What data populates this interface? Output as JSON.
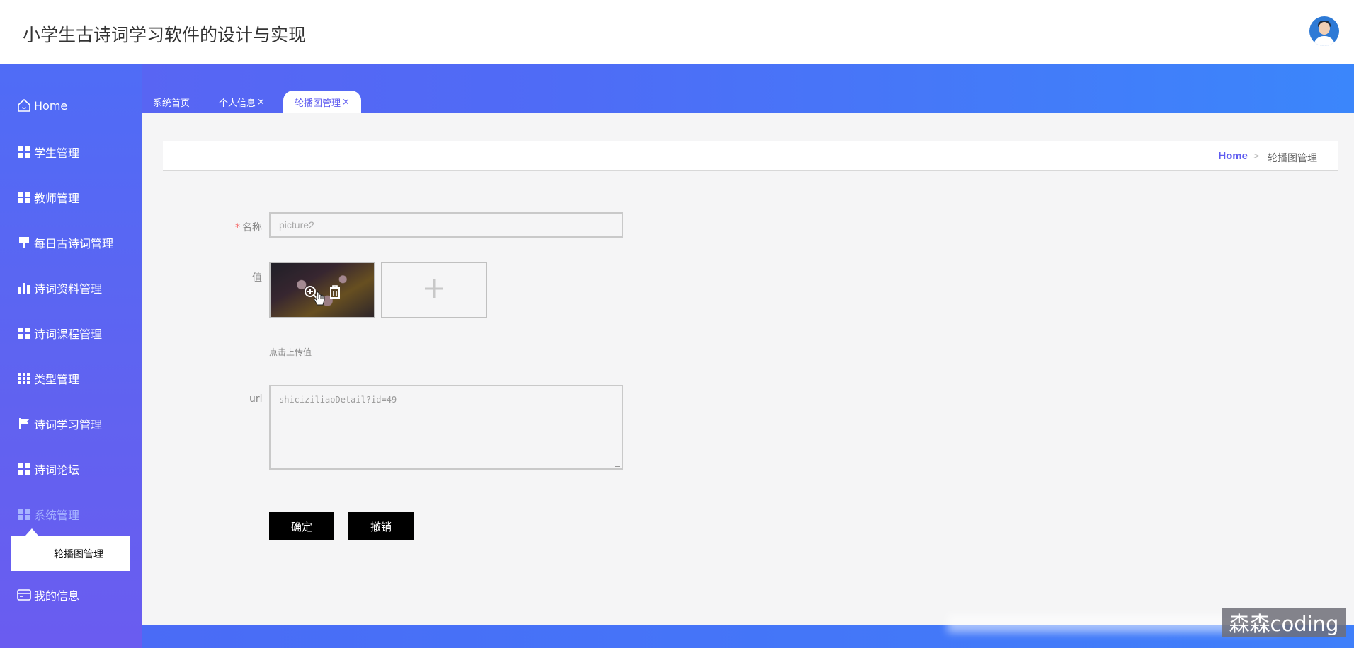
{
  "app": {
    "title": "小学生古诗词学习软件的设计与实现"
  },
  "sidebar": {
    "items": [
      {
        "label": "Home",
        "icon": "home-icon"
      },
      {
        "label": "学生管理",
        "icon": "grid-icon"
      },
      {
        "label": "教师管理",
        "icon": "grid-icon"
      },
      {
        "label": "每日古诗词管理",
        "icon": "brush-icon"
      },
      {
        "label": "诗词资料管理",
        "icon": "bar-chart-icon"
      },
      {
        "label": "诗词课程管理",
        "icon": "grid-icon"
      },
      {
        "label": "类型管理",
        "icon": "grid9-icon"
      },
      {
        "label": "诗词学习管理",
        "icon": "flag-icon"
      },
      {
        "label": "诗词论坛",
        "icon": "grid-icon"
      },
      {
        "label": "系统管理",
        "icon": "grid-icon"
      },
      {
        "label": "我的信息",
        "icon": "card-icon"
      }
    ],
    "submenu_item": "轮播图管理"
  },
  "tabs": [
    {
      "label": "系统首页"
    },
    {
      "label": "个人信息",
      "close": "×"
    },
    {
      "label": "轮播图管理",
      "close": "×",
      "active": true
    }
  ],
  "breadcrumb": {
    "home": "Home",
    "separator": ">",
    "current": "轮播图管理"
  },
  "form": {
    "name_label": "名称",
    "required_mark": "*",
    "name_value": "picture2",
    "value_label": "值",
    "upload_hint": "点击上传值",
    "url_label": "url",
    "url_value": "shiciziliaoDetail?id=49",
    "confirm": "确定",
    "cancel": "撤销"
  },
  "watermark": "森森coding",
  "colors": {
    "accent": "#5f5cf0",
    "sidebar": "#5a66f3",
    "band": "#3b86fb"
  }
}
